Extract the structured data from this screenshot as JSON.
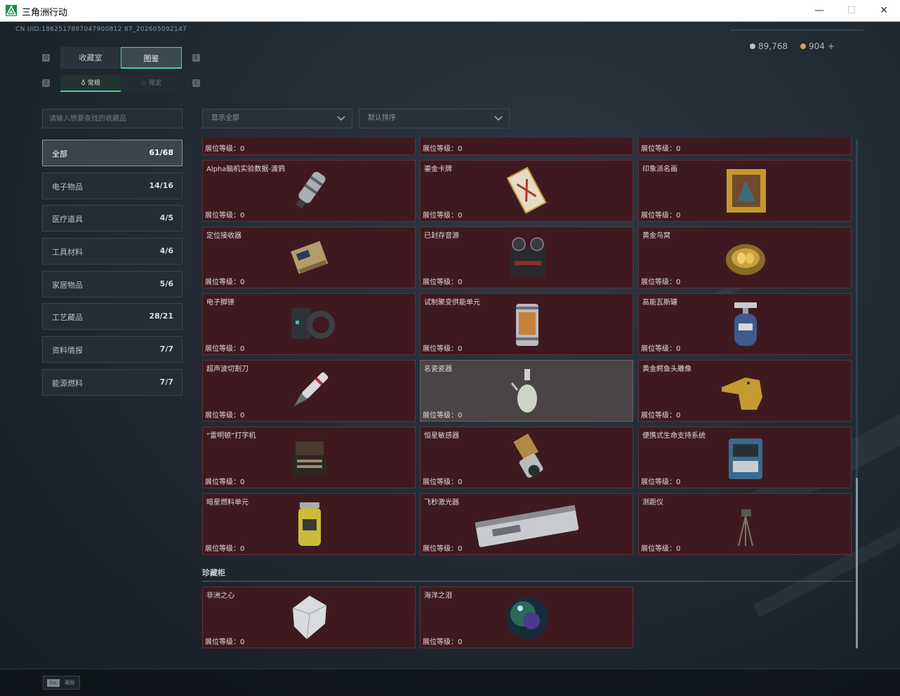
{
  "window": {
    "title": "三角洲行动",
    "min_symbol": "—",
    "max_symbol": "☐",
    "close_symbol": "✕"
  },
  "header": {
    "uid": "CN UID:1862517887047900812 87_202605092147",
    "currency": [
      {
        "name": "silver-coin-icon",
        "value": "89,768"
      },
      {
        "name": "gold-coin-icon",
        "value": "904 +"
      }
    ]
  },
  "tabs": [
    {
      "label": "收藏室",
      "active": false,
      "key": "Q"
    },
    {
      "label": "图鉴",
      "active": true,
      "key": "E"
    }
  ],
  "subtabs": [
    {
      "label": "常规",
      "icon": "flask-icon",
      "active": true,
      "key": "Z"
    },
    {
      "label": "限定",
      "icon": "star-icon",
      "active": false,
      "key": "C"
    }
  ],
  "search": {
    "placeholder": "请输入想要查找的收藏品",
    "value": ""
  },
  "filters": {
    "display": {
      "value": "显示全部"
    },
    "sort": {
      "value": "默认排序"
    }
  },
  "sidebar": {
    "items": [
      {
        "label": "全部",
        "count": "61/68",
        "active": true
      },
      {
        "label": "电子物品",
        "count": "14/16",
        "active": false
      },
      {
        "label": "医疗道具",
        "count": "4/5",
        "active": false
      },
      {
        "label": "工具材料",
        "count": "4/6",
        "active": false
      },
      {
        "label": "家居物品",
        "count": "5/6",
        "active": false
      },
      {
        "label": "工艺藏品",
        "count": "28/21",
        "active": false
      },
      {
        "label": "资料情报",
        "count": "7/7",
        "active": false
      },
      {
        "label": "能源燃料",
        "count": "7/7",
        "active": false
      }
    ]
  },
  "grid": {
    "level_label": "展位等级：",
    "partial_row": [
      {
        "name": "",
        "level": "0",
        "icon": "gold-bowl-icon"
      },
      {
        "name": "",
        "level": "0",
        "icon": "mechanical-part-icon"
      },
      {
        "name": "",
        "level": "0",
        "icon": "map-document-icon"
      }
    ],
    "items": [
      {
        "name": "Alpha脑机实验数据-渡鸦",
        "level": "0",
        "icon": "data-canister-icon",
        "highlight": false
      },
      {
        "name": "鎏金卡牌",
        "level": "0",
        "icon": "gilded-card-icon",
        "highlight": false
      },
      {
        "name": "印象派名画",
        "level": "0",
        "icon": "framed-painting-icon",
        "highlight": false
      },
      {
        "name": "定位接收器",
        "level": "0",
        "icon": "receiver-icon",
        "highlight": false
      },
      {
        "name": "已封存音源",
        "level": "0",
        "icon": "tape-recorder-icon",
        "highlight": false
      },
      {
        "name": "黄金鸟窝",
        "level": "0",
        "icon": "golden-nest-icon",
        "highlight": false
      },
      {
        "name": "电子脚镣",
        "level": "0",
        "icon": "ankle-monitor-icon",
        "highlight": false
      },
      {
        "name": "试制聚变供能单元",
        "level": "0",
        "icon": "fusion-cell-icon",
        "highlight": false
      },
      {
        "name": "高能瓦斯罐",
        "level": "0",
        "icon": "gas-tank-icon",
        "highlight": false
      },
      {
        "name": "超声波切割刀",
        "level": "0",
        "icon": "cutter-icon",
        "highlight": false
      },
      {
        "name": "名瓷瓷器",
        "level": "0",
        "icon": "porcelain-vase-icon",
        "highlight": true
      },
      {
        "name": "黄金鳄鱼头雕像",
        "level": "0",
        "icon": "gold-crocodile-icon",
        "highlight": false
      },
      {
        "name": "“雷明顿”打字机",
        "level": "0",
        "icon": "typewriter-icon",
        "highlight": false
      },
      {
        "name": "恒星敏感器",
        "level": "0",
        "icon": "star-sensor-icon",
        "highlight": false
      },
      {
        "name": "便携式生命支持系统",
        "level": "0",
        "icon": "life-support-icon",
        "highlight": false
      },
      {
        "name": "暗星燃料单元",
        "level": "0",
        "icon": "fuel-cell-icon",
        "highlight": false
      },
      {
        "name": "飞秒激光器",
        "level": "0",
        "icon": "laser-device-icon",
        "highlight": false
      },
      {
        "name": "测距仪",
        "level": "0",
        "icon": "rangefinder-tripod-icon",
        "highlight": false
      }
    ]
  },
  "treasure": {
    "title": "珍藏柜",
    "items": [
      {
        "name": "非洲之心",
        "level": "0",
        "icon": "diamond-icon"
      },
      {
        "name": "海洋之泪",
        "level": "0",
        "icon": "ocean-pearl-icon"
      }
    ]
  },
  "footer": {
    "esc_key": "Esc",
    "esc_label": "返回"
  }
}
